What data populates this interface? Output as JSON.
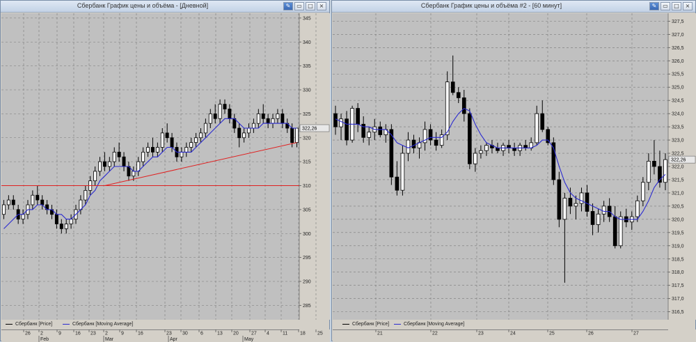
{
  "windows": [
    {
      "title": "Сбербанк График цены и объёма - [Дневной]",
      "legend": [
        {
          "label": "Сбербанк [Price]",
          "color": "#000000"
        },
        {
          "label": "Сбербанк [Moving Average]",
          "color": "#2a2ad0"
        }
      ],
      "current_price_label": "322,26",
      "chart_data": {
        "type": "candlestick",
        "y_ticks": [
          "345",
          "340",
          "335",
          "330",
          "325",
          "320",
          "315",
          "310",
          "305",
          "300",
          "295",
          "290",
          "285"
        ],
        "ylim": [
          282,
          346
        ],
        "x_ticks": [
          "26",
          "2",
          "9",
          "16",
          "23",
          "2",
          "9",
          "16",
          "23",
          "30",
          "6",
          "13",
          "20",
          "27",
          "4",
          "11",
          "18",
          "25"
        ],
        "x_months": [
          "Feb",
          "Mar",
          "Apr",
          "May"
        ],
        "ohlc": [
          [
            304,
            307,
            303,
            306
          ],
          [
            306,
            308,
            305,
            307
          ],
          [
            307,
            308,
            305,
            306
          ],
          [
            305,
            306,
            302,
            303
          ],
          [
            303,
            305,
            302,
            304
          ],
          [
            304,
            307,
            303,
            306
          ],
          [
            306,
            309,
            305,
            308
          ],
          [
            308,
            310,
            306,
            307
          ],
          [
            307,
            308,
            305,
            306
          ],
          [
            306,
            307,
            304,
            305
          ],
          [
            305,
            306,
            303,
            304
          ],
          [
            304,
            305,
            301,
            302
          ],
          [
            302,
            303,
            300,
            301
          ],
          [
            301,
            303,
            300,
            302
          ],
          [
            302,
            304,
            301,
            303
          ],
          [
            303,
            306,
            302,
            305
          ],
          [
            305,
            308,
            304,
            307
          ],
          [
            307,
            310,
            306,
            309
          ],
          [
            309,
            312,
            308,
            311
          ],
          [
            311,
            314,
            310,
            313
          ],
          [
            313,
            316,
            312,
            315
          ],
          [
            315,
            317,
            313,
            314
          ],
          [
            314,
            316,
            313,
            315
          ],
          [
            315,
            318,
            314,
            317
          ],
          [
            317,
            319,
            315,
            316
          ],
          [
            316,
            317,
            313,
            314
          ],
          [
            314,
            315,
            311,
            312
          ],
          [
            312,
            314,
            311,
            313
          ],
          [
            313,
            316,
            312,
            315
          ],
          [
            315,
            318,
            314,
            317
          ],
          [
            317,
            319,
            316,
            318
          ],
          [
            318,
            320,
            316,
            317
          ],
          [
            317,
            319,
            316,
            318
          ],
          [
            318,
            322,
            317,
            321
          ],
          [
            321,
            323,
            319,
            320
          ],
          [
            320,
            321,
            317,
            318
          ],
          [
            318,
            319,
            315,
            316
          ],
          [
            316,
            318,
            315,
            317
          ],
          [
            317,
            319,
            316,
            318
          ],
          [
            318,
            320,
            317,
            319
          ],
          [
            319,
            321,
            318,
            320
          ],
          [
            320,
            322,
            319,
            321
          ],
          [
            321,
            324,
            320,
            323
          ],
          [
            323,
            326,
            322,
            325
          ],
          [
            325,
            327,
            323,
            324
          ],
          [
            324,
            328,
            323,
            327
          ],
          [
            327,
            328,
            325,
            326
          ],
          [
            326,
            327,
            323,
            324
          ],
          [
            324,
            325,
            321,
            322
          ],
          [
            322,
            323,
            318,
            320
          ],
          [
            320,
            322,
            319,
            321
          ],
          [
            321,
            323,
            320,
            322
          ],
          [
            322,
            324,
            321,
            323
          ],
          [
            323,
            326,
            322,
            325
          ],
          [
            325,
            327,
            323,
            324
          ],
          [
            324,
            325,
            322,
            323
          ],
          [
            323,
            325,
            322,
            324
          ],
          [
            324,
            326,
            323,
            325
          ],
          [
            325,
            326,
            322,
            323
          ],
          [
            323,
            324,
            321,
            322
          ],
          [
            322,
            323,
            318,
            319
          ],
          [
            319,
            322,
            318,
            322
          ]
        ],
        "moving_average": [
          301,
          302,
          303,
          304,
          304,
          305,
          305,
          306,
          306,
          305,
          305,
          304,
          304,
          303,
          303,
          304,
          305,
          306,
          308,
          309,
          311,
          312,
          313,
          314,
          314,
          314,
          314,
          313,
          313,
          314,
          315,
          316,
          316,
          317,
          318,
          318,
          317,
          317,
          317,
          317,
          318,
          319,
          320,
          321,
          322,
          323,
          324,
          324,
          324,
          323,
          322,
          322,
          322,
          322,
          323,
          323,
          323,
          323,
          323,
          323,
          322,
          322
        ],
        "horizontal_line": {
          "value": 310,
          "color": "#e02020"
        },
        "trend_line": {
          "from": [
            21,
            310
          ],
          "to": [
            61,
            319
          ],
          "color": "#e02020"
        }
      }
    },
    {
      "title": "Сбербанк График цены и объёма #2 - [60 минут]",
      "legend": [
        {
          "label": "Сбербанк [Price]",
          "color": "#000000"
        },
        {
          "label": "Сбербанк [Moving Average]",
          "color": "#2a2ad0"
        }
      ],
      "current_price_label": "322,26",
      "chart_data": {
        "type": "candlestick",
        "y_ticks": [
          "327,5",
          "327,0",
          "326,5",
          "326,0",
          "325,5",
          "325,0",
          "324,5",
          "324,0",
          "323,5",
          "323,0",
          "322,5",
          "322,0",
          "321,5",
          "321,0",
          "320,5",
          "320,0",
          "319,5",
          "319,0",
          "318,5",
          "318,0",
          "317,5",
          "317,0",
          "316,5"
        ],
        "ylim": [
          316.2,
          327.8
        ],
        "x_ticks": [
          "21",
          "22",
          "23",
          "24",
          "25",
          "26",
          "27"
        ],
        "ohlc": [
          [
            324.0,
            324.3,
            323.2,
            323.5
          ],
          [
            323.5,
            324.0,
            323.0,
            323.8
          ],
          [
            323.8,
            324.1,
            322.8,
            323.0
          ],
          [
            323.0,
            324.3,
            322.9,
            324.2
          ],
          [
            324.2,
            324.4,
            323.3,
            323.6
          ],
          [
            323.6,
            323.9,
            322.9,
            323.1
          ],
          [
            323.1,
            323.5,
            322.8,
            323.3
          ],
          [
            323.3,
            323.8,
            323.0,
            323.5
          ],
          [
            323.5,
            323.7,
            323.1,
            323.2
          ],
          [
            323.2,
            323.6,
            322.9,
            323.4
          ],
          [
            323.4,
            323.6,
            321.3,
            321.6
          ],
          [
            321.6,
            322.2,
            320.9,
            321.1
          ],
          [
            321.1,
            322.8,
            320.9,
            322.5
          ],
          [
            322.5,
            323.3,
            322.2,
            323.0
          ],
          [
            323.0,
            323.2,
            322.5,
            322.7
          ],
          [
            322.7,
            323.1,
            322.3,
            322.9
          ],
          [
            322.9,
            323.7,
            322.6,
            323.4
          ],
          [
            323.4,
            323.6,
            322.8,
            323.0
          ],
          [
            323.0,
            323.3,
            322.6,
            322.8
          ],
          [
            322.8,
            323.4,
            322.7,
            323.2
          ],
          [
            323.2,
            325.6,
            323.0,
            325.2
          ],
          [
            325.2,
            326.2,
            324.7,
            324.8
          ],
          [
            324.8,
            325.0,
            324.4,
            324.6
          ],
          [
            324.6,
            324.9,
            323.7,
            324.0
          ],
          [
            324.0,
            324.2,
            321.9,
            322.1
          ],
          [
            322.1,
            322.7,
            321.8,
            322.5
          ],
          [
            322.5,
            322.8,
            322.3,
            322.6
          ],
          [
            322.6,
            322.9,
            322.4,
            322.8
          ],
          [
            322.8,
            323.0,
            322.5,
            322.7
          ],
          [
            322.7,
            322.9,
            322.5,
            322.6
          ],
          [
            322.6,
            322.9,
            322.4,
            322.8
          ],
          [
            322.8,
            323.0,
            322.5,
            322.7
          ],
          [
            322.7,
            322.9,
            322.4,
            322.6
          ],
          [
            322.6,
            322.9,
            322.4,
            322.8
          ],
          [
            322.8,
            323.0,
            322.6,
            322.7
          ],
          [
            322.7,
            323.1,
            322.6,
            322.9
          ],
          [
            322.9,
            324.3,
            322.8,
            324.0
          ],
          [
            324.0,
            324.5,
            323.3,
            323.4
          ],
          [
            323.4,
            323.5,
            322.8,
            322.9
          ],
          [
            322.9,
            323.1,
            321.3,
            321.5
          ],
          [
            321.5,
            321.8,
            319.7,
            320.0
          ],
          [
            320.0,
            321.0,
            317.6,
            320.8
          ],
          [
            320.8,
            321.2,
            320.2,
            320.5
          ],
          [
            320.5,
            320.9,
            320.0,
            320.6
          ],
          [
            320.6,
            321.2,
            320.3,
            321.0
          ],
          [
            321.0,
            321.3,
            320.1,
            320.3
          ],
          [
            320.3,
            320.6,
            319.4,
            319.8
          ],
          [
            319.8,
            320.4,
            319.5,
            320.2
          ],
          [
            320.2,
            320.7,
            319.9,
            320.5
          ],
          [
            320.5,
            320.8,
            319.9,
            320.1
          ],
          [
            320.1,
            320.5,
            318.9,
            319.0
          ],
          [
            319.0,
            320.3,
            318.9,
            320.1
          ],
          [
            320.1,
            320.4,
            319.7,
            319.9
          ],
          [
            319.9,
            320.3,
            319.6,
            320.1
          ],
          [
            320.1,
            320.9,
            319.9,
            320.7
          ],
          [
            320.7,
            321.6,
            320.5,
            321.4
          ],
          [
            321.4,
            322.5,
            321.1,
            322.2
          ],
          [
            322.2,
            323.0,
            321.7,
            322.0
          ],
          [
            322.0,
            322.6,
            321.2,
            321.4
          ],
          [
            321.4,
            322.5,
            321.1,
            322.26
          ]
        ],
        "moving_average": [
          323.8,
          323.7,
          323.6,
          323.6,
          323.6,
          323.5,
          323.5,
          323.4,
          323.4,
          323.4,
          323.2,
          322.9,
          322.8,
          322.7,
          322.8,
          322.9,
          323.0,
          323.1,
          323.1,
          323.1,
          323.3,
          323.7,
          324.0,
          324.2,
          324.1,
          323.6,
          323.2,
          322.9,
          322.8,
          322.7,
          322.7,
          322.7,
          322.7,
          322.7,
          322.7,
          322.7,
          322.8,
          323.0,
          323.0,
          322.7,
          322.0,
          321.4,
          321.0,
          320.8,
          320.7,
          320.6,
          320.5,
          320.4,
          320.3,
          320.3,
          320.1,
          320.0,
          320.0,
          320.0,
          320.0,
          320.3,
          320.7,
          321.2,
          321.5,
          321.7
        ]
      }
    }
  ]
}
